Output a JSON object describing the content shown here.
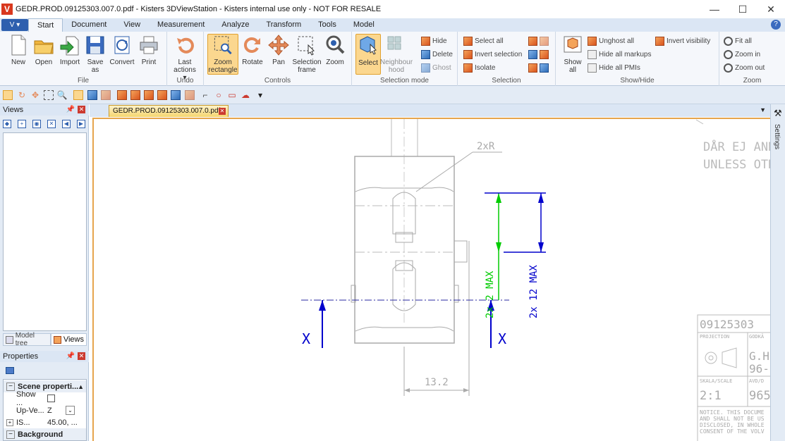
{
  "window": {
    "logo": "V",
    "title": "GEDR.PROD.09125303.007.0.pdf - Kisters 3DViewStation - Kisters internal use only - NOT FOR RESALE",
    "minimize": "—",
    "maximize": "☐",
    "close": "✕"
  },
  "menu": {
    "app_button": "V ▾",
    "tabs": [
      "Start",
      "Document",
      "View",
      "Measurement",
      "Analyze",
      "Transform",
      "Tools",
      "Model"
    ],
    "active_tab": "Start",
    "help": "?"
  },
  "ribbon": {
    "file": {
      "label": "File",
      "new": "New",
      "open": "Open",
      "import": "Import",
      "save_as": "Save as",
      "convert": "Convert",
      "print": "Print"
    },
    "undo": {
      "label": "Undo",
      "last_actions": "Last actions ▾"
    },
    "controls": {
      "label": "Controls",
      "zoom_rectangle": "Zoom rectangle",
      "rotate": "Rotate",
      "pan": "Pan",
      "selection_frame": "Selection frame",
      "zoom": "Zoom"
    },
    "selection_mode": {
      "label": "Selection mode",
      "select": "Select",
      "neighbourhood": "Neighbour hood",
      "hide": "Hide",
      "delete": "Delete",
      "ghost": "Ghost"
    },
    "selection": {
      "label": "Selection",
      "select_all": "Select all",
      "invert_selection": "Invert selection",
      "isolate": "Isolate"
    },
    "show_hide": {
      "label": "Show/Hide",
      "show_all": "Show all",
      "unghost_all": "Unghost all",
      "hide_all_markups": "Hide all markups",
      "hide_all_pmis": "Hide all PMIs",
      "invert_visibility": "Invert visibility"
    },
    "zoom": {
      "label": "Zoom",
      "fit_all": "Fit all",
      "zoom_in": "Zoom in",
      "zoom_out": "Zoom out"
    }
  },
  "quick_toolbar": {
    "more": "▾"
  },
  "views_pane": {
    "title": "Views",
    "pin": "📌",
    "close": "✕"
  },
  "pane_tabs": {
    "model_tree": "Model tree",
    "views": "Views"
  },
  "properties": {
    "title": "Properties",
    "pin": "📌",
    "close": "✕",
    "scene_properties": "Scene properti...",
    "show_label": "Show ...",
    "up_vector_label": "Up-Ve...",
    "up_vector_value": "Z",
    "iso_label": "IS...",
    "iso_value": "45.00, ...",
    "background": "Background"
  },
  "document": {
    "tab_name": "GEDR.PROD.09125303.007.0.pdf",
    "tab_close": "✕",
    "tabs_dropdown": "▼"
  },
  "settings_panel": {
    "label": "Settings"
  },
  "drawing": {
    "radius_label": "2xR",
    "dim_green": "2x 2 MAX",
    "dim_blue": "2x 12 MAX",
    "dim_width": "13.2",
    "section_marker": "X",
    "note_line1": "DÅR EJ ANN",
    "note_line2": "UNLESS OTH",
    "part_number": "09125303",
    "projection_label": "PROJECTION",
    "name_label": "GODKÄ",
    "designer_prefix": "G.H",
    "date_prefix": "96-",
    "scale_label": "SKALA/SCALE",
    "scale_value": "2:1",
    "drawing_label": "AVD/D",
    "drawing_value": "965",
    "notice_1": "NOTICE. THIS DOCUME",
    "notice_2": "AND SHALL NOT BE US",
    "notice_3": "DISCLOSED, IN WHOLE",
    "notice_4": "CONSENT OF THE VOLV"
  },
  "colors": {
    "accent": "#2d5fae",
    "active_tab": "#f5d56e",
    "dim_blue": "#0000cc",
    "dim_green": "#00cc00"
  }
}
